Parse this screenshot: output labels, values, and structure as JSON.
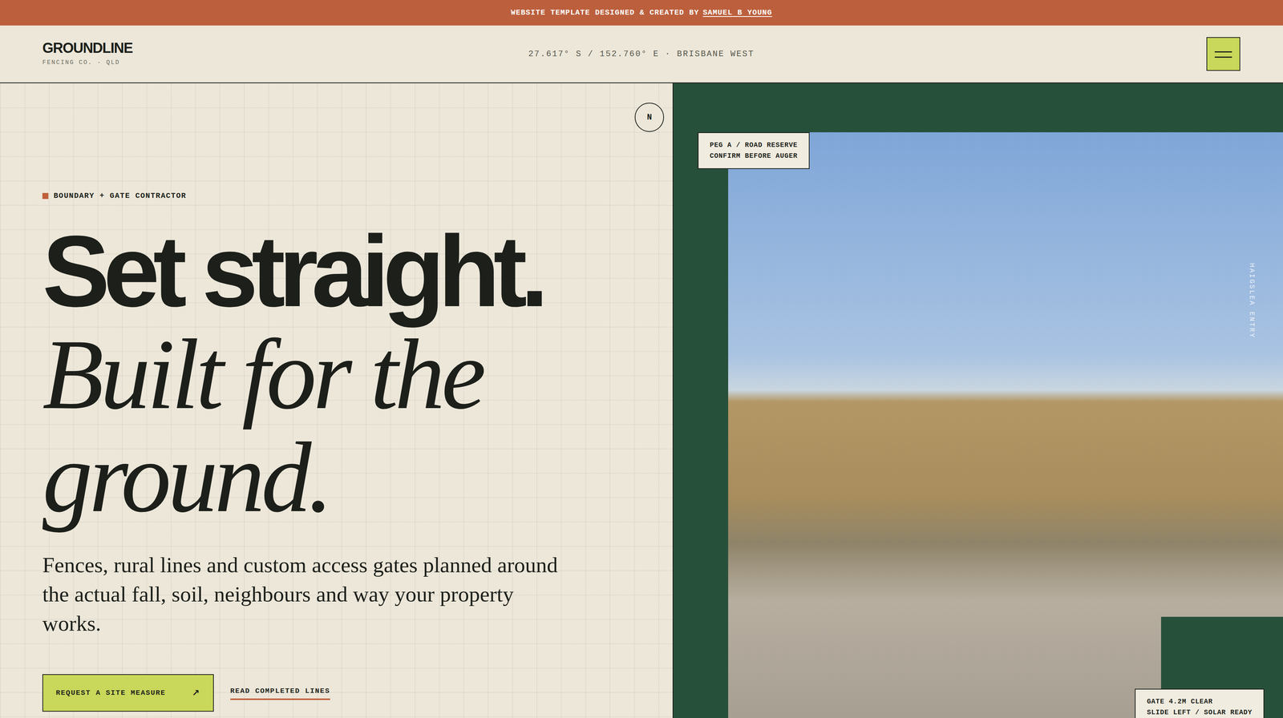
{
  "banner": {
    "text": "WEBSITE TEMPLATE DESIGNED & CREATED BY",
    "link": "SAMUEL B YOUNG"
  },
  "header": {
    "logo": "GROUNDLINE",
    "tagline": "FENCING CO. · QLD",
    "coordinates": "27.617° S / 152.760° E · BRISBANE WEST"
  },
  "hero": {
    "compass": "N",
    "eyebrow": "BOUNDARY + GATE CONTRACTOR",
    "headline": "Set straight.",
    "headline_italic": [
      "Built for the",
      "ground."
    ],
    "lead": "Fences, rural lines and custom access gates planned around the actual fall, soil, neighbours and way your property works.",
    "buttons": [
      {
        "label": "REQUEST A SITE MEASURE",
        "icon": "↗",
        "kind": "primary"
      },
      {
        "label": "READ COMPLETED LINES",
        "icon": "",
        "kind": "link"
      }
    ]
  },
  "photo": {
    "caption": "HAIGSLEA ENTRY",
    "notes": [
      {
        "lines": [
          "PEG A / ROAD RESERVE",
          "CONFIRM BEFORE AUGER"
        ]
      },
      {
        "lines": [
          "GATE 4.2M CLEAR",
          "SLIDE LEFT / SOLAR READY"
        ]
      }
    ]
  }
}
